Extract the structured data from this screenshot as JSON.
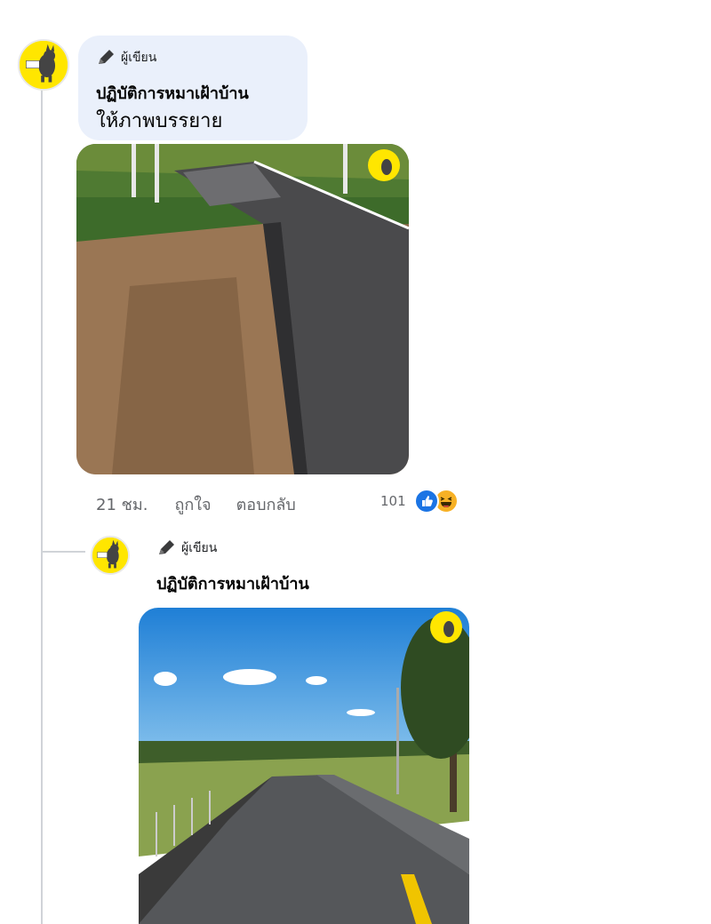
{
  "comment1": {
    "author_badge": "ผู้เขียน",
    "author_name": "ปฏิบัติการหมาเฝ้าบ้าน",
    "text": "ให้ภาพบรรยาย",
    "time": "21 ชม.",
    "like_label": "ถูกใจ",
    "reply_label": "ตอบกลับ",
    "reaction_count": "101",
    "reactions": [
      "like-icon",
      "haha-icon"
    ]
  },
  "reply1": {
    "author_badge": "ผู้เขียน",
    "author_name": "ปฏิบัติการหมาเฝ้าบ้าน"
  },
  "colors": {
    "bubble": "#eaf0fb",
    "like_blue": "#1b74e4",
    "haha_yellow": "#f7b125",
    "avatar_yellow": "#ffe600"
  }
}
